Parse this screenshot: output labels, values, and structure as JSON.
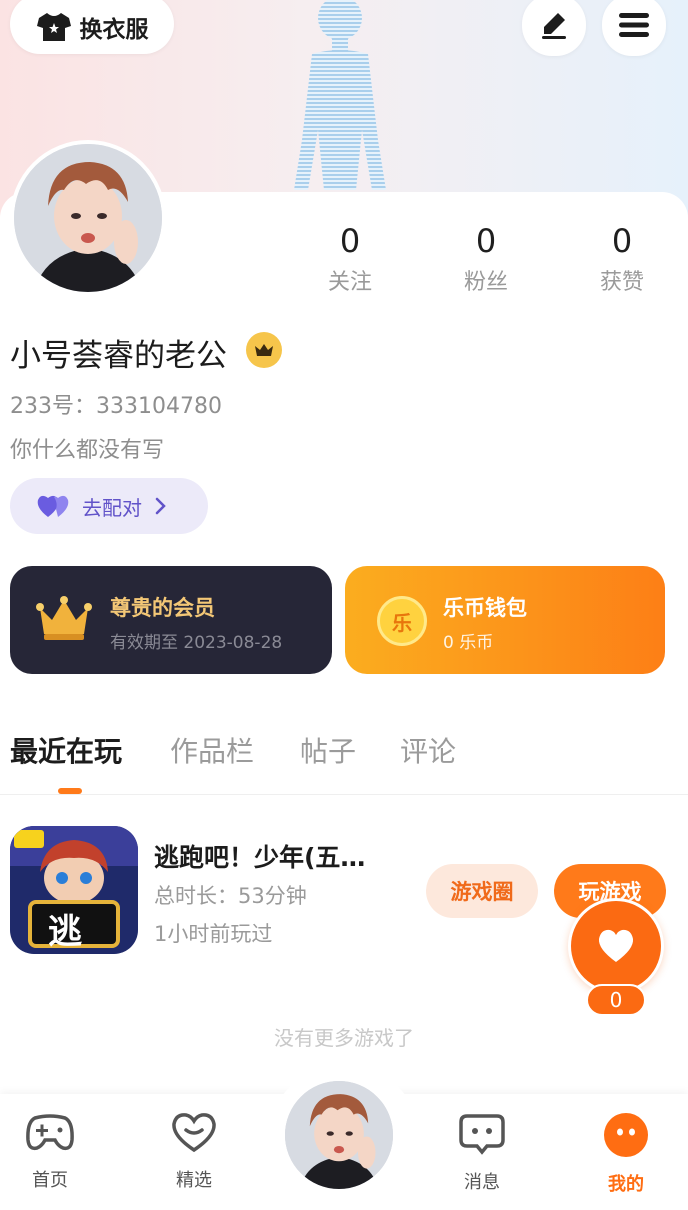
{
  "header": {
    "dress_label": "换衣服",
    "dress_icon": "shirt-icon",
    "edit_icon": "pen-icon",
    "menu_icon": "menu-icon"
  },
  "profile": {
    "stats": [
      {
        "value": "0",
        "label": "关注"
      },
      {
        "value": "0",
        "label": "粉丝"
      },
      {
        "value": "0",
        "label": "获赞"
      }
    ],
    "nickname": "小号荟睿的老公",
    "uid": "233号：333104780",
    "bio": "你什么都没有写",
    "pair_label": "去配对"
  },
  "cards": {
    "vip": {
      "title": "尊贵的会员",
      "subtitle": "有效期至 2023-08-28"
    },
    "wallet": {
      "title": "乐币钱包",
      "subtitle": "0 乐币",
      "coin_glyph": "乐"
    }
  },
  "tabs": [
    "最近在玩",
    "作品栏",
    "帖子",
    "评论"
  ],
  "game": {
    "title": "逃跑吧！少年(五…",
    "duration": "总时长：53分钟",
    "last_played": "1小时前玩过",
    "icon_char": "逃",
    "circle_label": "游戏圈",
    "play_label": "玩游戏"
  },
  "like_count": "0",
  "no_more": "没有更多游戏了",
  "nav": [
    {
      "label": "首页",
      "icon": "gamepad-icon"
    },
    {
      "label": "精选",
      "icon": "heart-outline-icon"
    },
    {
      "label": "消息",
      "icon": "chat-icon"
    },
    {
      "label": "我的",
      "icon": "face-icon"
    }
  ],
  "colors": {
    "accent": "#ff7a1a",
    "vip_bg": "#262637",
    "vip_gold": "#f3c776",
    "pair_purple": "#6153c9"
  }
}
